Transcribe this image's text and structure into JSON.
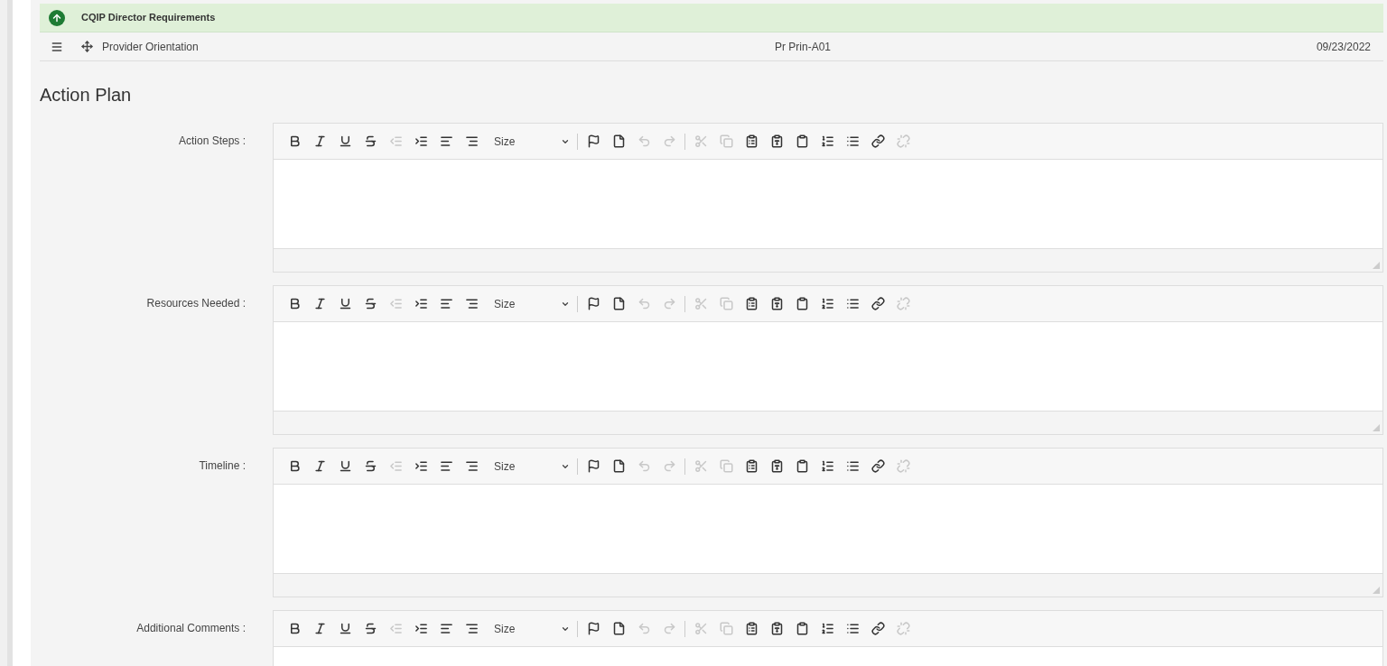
{
  "section_header": {
    "title": "CQIP Director Requirements"
  },
  "item_row": {
    "name": "Provider Orientation",
    "code": "Pr Prin-A01",
    "date": "09/23/2022"
  },
  "page_title": "Action Plan",
  "editors": [
    {
      "label": "Action Steps :",
      "size_select": "Size",
      "tools": [
        {
          "disabled": false
        },
        {
          "disabled": false
        },
        {
          "disabled": false
        },
        {
          "disabled": false
        },
        {
          "disabled": true
        },
        {
          "disabled": false
        },
        {
          "disabled": false
        },
        {
          "disabled": false
        },
        {
          "disabled": false
        },
        {
          "disabled": false
        },
        {
          "disabled": true
        },
        {
          "disabled": true
        },
        {
          "disabled": true
        },
        {
          "disabled": true
        },
        {
          "disabled": false
        },
        {
          "disabled": false
        },
        {
          "disabled": false
        },
        {
          "disabled": false
        },
        {
          "disabled": false
        },
        {
          "disabled": false
        },
        {
          "disabled": true
        }
      ]
    },
    {
      "label": "Resources Needed :",
      "size_select": "Size",
      "tools": [
        {
          "disabled": false
        },
        {
          "disabled": false
        },
        {
          "disabled": false
        },
        {
          "disabled": false
        },
        {
          "disabled": true
        },
        {
          "disabled": false
        },
        {
          "disabled": false
        },
        {
          "disabled": false
        },
        {
          "disabled": false
        },
        {
          "disabled": false
        },
        {
          "disabled": true
        },
        {
          "disabled": true
        },
        {
          "disabled": true
        },
        {
          "disabled": true
        },
        {
          "disabled": false
        },
        {
          "disabled": false
        },
        {
          "disabled": false
        },
        {
          "disabled": false
        },
        {
          "disabled": false
        },
        {
          "disabled": false
        },
        {
          "disabled": true
        }
      ]
    },
    {
      "label": "Timeline :",
      "size_select": "Size",
      "tools": [
        {
          "disabled": false
        },
        {
          "disabled": false
        },
        {
          "disabled": false
        },
        {
          "disabled": false
        },
        {
          "disabled": true
        },
        {
          "disabled": false
        },
        {
          "disabled": false
        },
        {
          "disabled": false
        },
        {
          "disabled": false
        },
        {
          "disabled": false
        },
        {
          "disabled": true
        },
        {
          "disabled": true
        },
        {
          "disabled": true
        },
        {
          "disabled": true
        },
        {
          "disabled": false
        },
        {
          "disabled": false
        },
        {
          "disabled": false
        },
        {
          "disabled": false
        },
        {
          "disabled": false
        },
        {
          "disabled": false
        },
        {
          "disabled": true
        }
      ]
    },
    {
      "label": "Additional Comments :",
      "size_select": "Size",
      "tools": [
        {
          "disabled": false
        },
        {
          "disabled": false
        },
        {
          "disabled": false
        },
        {
          "disabled": false
        },
        {
          "disabled": true
        },
        {
          "disabled": false
        },
        {
          "disabled": false
        },
        {
          "disabled": false
        },
        {
          "disabled": false
        },
        {
          "disabled": false
        },
        {
          "disabled": true
        },
        {
          "disabled": true
        },
        {
          "disabled": true
        },
        {
          "disabled": true
        },
        {
          "disabled": false
        },
        {
          "disabled": false
        },
        {
          "disabled": false
        },
        {
          "disabled": false
        },
        {
          "disabled": false
        },
        {
          "disabled": false
        },
        {
          "disabled": true
        }
      ]
    }
  ]
}
